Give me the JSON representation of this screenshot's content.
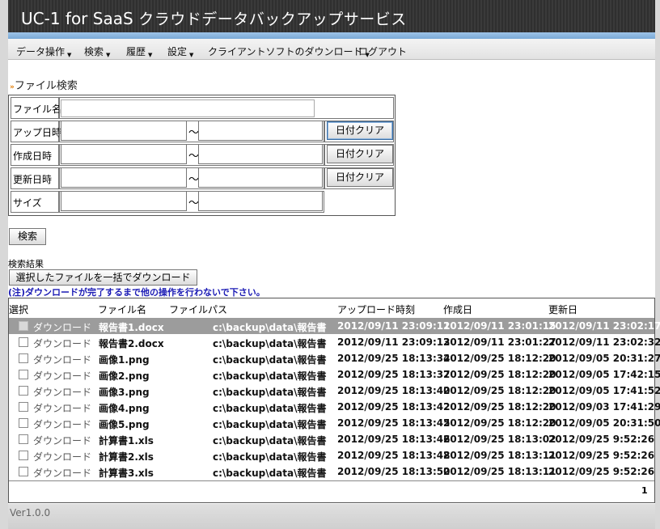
{
  "header": {
    "title_brand": "UC-1 for SaaS",
    "title_rest": " クラウドデータバックアップサービス"
  },
  "menu": [
    {
      "label": "データ操作",
      "dropdown": true
    },
    {
      "label": "検索",
      "dropdown": true
    },
    {
      "label": "履歴",
      "dropdown": true
    },
    {
      "label": "設定",
      "dropdown": true
    },
    {
      "label": "クライアントソフトのダウンロード",
      "dropdown": true
    },
    {
      "label": "ログアウト",
      "dropdown": false
    }
  ],
  "search": {
    "section_title": "ファイル検索",
    "rows": {
      "filename": {
        "label": "ファイル名",
        "value": ""
      },
      "upload": {
        "label": "アップ日時",
        "from": "",
        "to": "",
        "clear": "日付クリア"
      },
      "created": {
        "label": "作成日時",
        "from": "",
        "to": "",
        "clear": "日付クリア"
      },
      "updated": {
        "label": "更新日時",
        "from": "",
        "to": "",
        "clear": "日付クリア"
      },
      "size": {
        "label": "サイズ",
        "from": "",
        "to": ""
      }
    },
    "range_separator": "～",
    "search_button": "検索"
  },
  "results": {
    "label": "検索結果",
    "bulk_download_button": "選択したファイルを一括でダウンロード",
    "note": "(注)ダウンロードが完了するまで他の操作を行わないで下さい。",
    "columns": {
      "select": "選択",
      "filename": "ファイル名",
      "filepath": "ファイルパス",
      "uploaded": "アップロード時刻",
      "created": "作成日",
      "updated": "更新日"
    },
    "download_link": "ダウンロード",
    "rows": [
      {
        "name": "報告書1.docx",
        "path": "c:\\backup\\data\\報告書",
        "uploaded": "2012/09/11 23:09:11",
        "created": "2012/09/11 23:01:15",
        "updated": "2012/09/11 23:02:17",
        "selected": true
      },
      {
        "name": "報告書2.docx",
        "path": "c:\\backup\\data\\報告書",
        "uploaded": "2012/09/11 23:09:13",
        "created": "2012/09/11 23:01:27",
        "updated": "2012/09/11 23:02:32",
        "selected": false
      },
      {
        "name": "画像1.png",
        "path": "c:\\backup\\data\\報告書",
        "uploaded": "2012/09/25 18:13:34",
        "created": "2012/09/25 18:12:20",
        "updated": "2012/09/05 20:31:27",
        "selected": false
      },
      {
        "name": "画像2.png",
        "path": "c:\\backup\\data\\報告書",
        "uploaded": "2012/09/25 18:13:37",
        "created": "2012/09/25 18:12:20",
        "updated": "2012/09/05 17:42:15",
        "selected": false
      },
      {
        "name": "画像3.png",
        "path": "c:\\backup\\data\\報告書",
        "uploaded": "2012/09/25 18:13:40",
        "created": "2012/09/25 18:12:20",
        "updated": "2012/09/05 17:41:52",
        "selected": false
      },
      {
        "name": "画像4.png",
        "path": "c:\\backup\\data\\報告書",
        "uploaded": "2012/09/25 18:13:42",
        "created": "2012/09/25 18:12:20",
        "updated": "2012/09/03 17:41:29",
        "selected": false
      },
      {
        "name": "画像5.png",
        "path": "c:\\backup\\data\\報告書",
        "uploaded": "2012/09/25 18:13:45",
        "created": "2012/09/25 18:12:20",
        "updated": "2012/09/05 20:31:50",
        "selected": false
      },
      {
        "name": "計算書1.xls",
        "path": "c:\\backup\\data\\報告書",
        "uploaded": "2012/09/25 18:13:46",
        "created": "2012/09/25 18:13:02",
        "updated": "2012/09/25 9:52:26",
        "selected": false
      },
      {
        "name": "計算書2.xls",
        "path": "c:\\backup\\data\\報告書",
        "uploaded": "2012/09/25 18:13:48",
        "created": "2012/09/25 18:13:11",
        "updated": "2012/09/25 9:52:26",
        "selected": false
      },
      {
        "name": "計算書3.xls",
        "path": "c:\\backup\\data\\報告書",
        "uploaded": "2012/09/25 18:13:50",
        "created": "2012/09/25 18:13:11",
        "updated": "2012/09/25 9:52:26",
        "selected": false
      }
    ],
    "page": "1"
  },
  "footer": {
    "version": "Ver1.0.0"
  }
}
